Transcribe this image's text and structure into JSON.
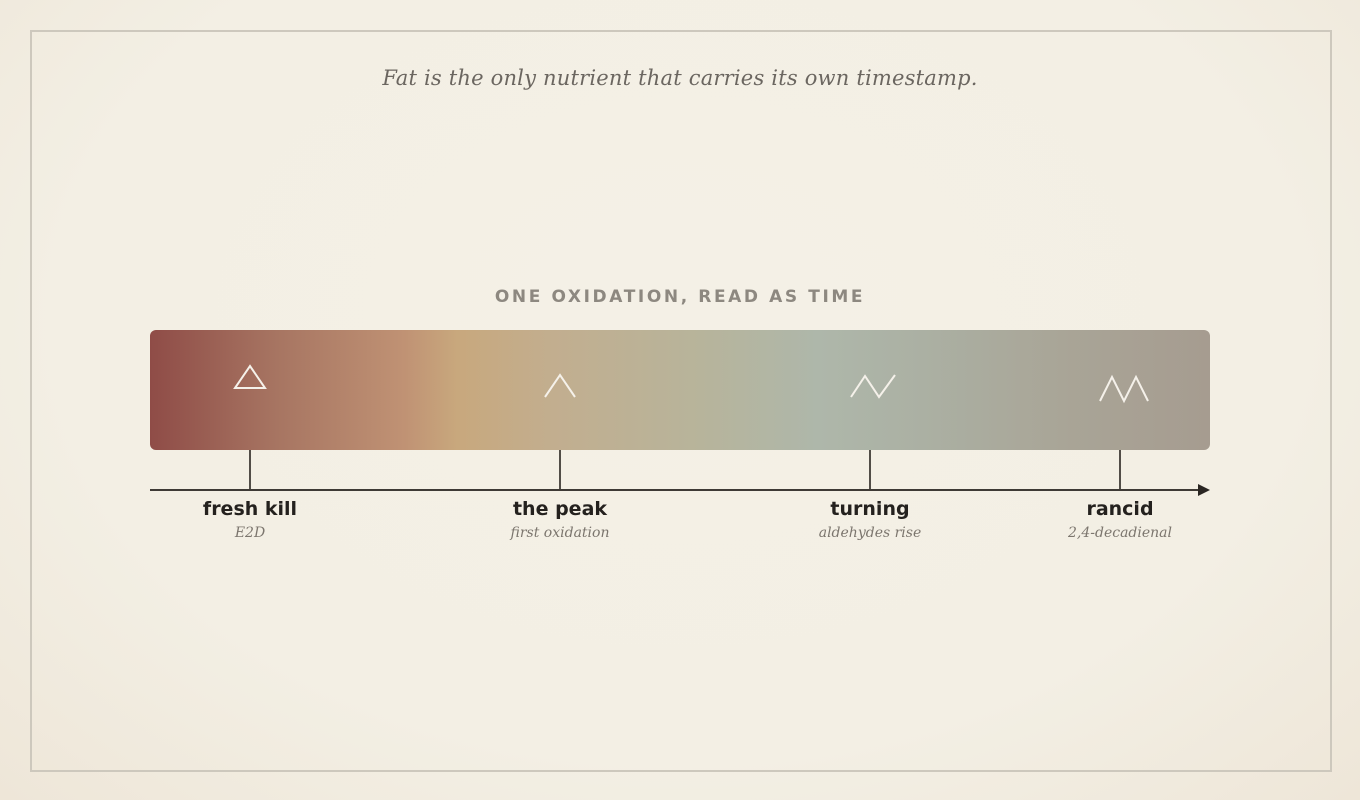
{
  "epigraph": "Fat is the only nutrient that carries its own timestamp.",
  "section_title": "ONE OXIDATION, READ AS TIME",
  "colors": {
    "band_start": "#8f4c47",
    "band_peak": "#c8a87d",
    "band_turning": "#aeb7aa",
    "band_end": "#a69c90",
    "glyph_stroke": "#f5f1ea",
    "axis": "#3e3a35"
  },
  "stages": [
    {
      "label": "fresh kill",
      "sub": "E2D",
      "glyph": "triangle-glyph"
    },
    {
      "label": "the peak",
      "sub": "first oxidation",
      "glyph": "single-peak-glyph"
    },
    {
      "label": "turning",
      "sub": "aldehydes rise",
      "glyph": "peak-and-rise-glyph"
    },
    {
      "label": "rancid",
      "sub": "2,4-decadienal",
      "glyph": "double-peak-glyph"
    }
  ]
}
